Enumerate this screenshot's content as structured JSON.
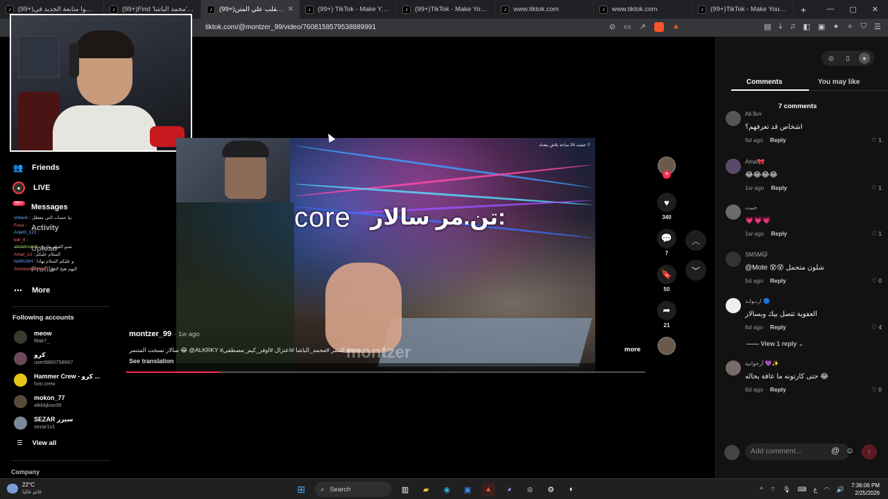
{
  "browser": {
    "tabs": [
      {
        "title": "(99+)لا تنسوا متابعة الجديد في",
        "active": false
      },
      {
        "title": "(99+)Find 'محمد الباشا' on TikTok",
        "active": false
      },
      {
        "title": "(99+)سالار ينقلب علي المتن",
        "active": true
      },
      {
        "title": "(99+) TikTok - Make Your Day",
        "active": false
      },
      {
        "title": "(99+)TikTok - Make Your Day",
        "active": false
      },
      {
        "title": "www.tiktok.com",
        "active": false
      },
      {
        "title": "www.tiktok.com",
        "active": false
      },
      {
        "title": "(99+)TikTok - Make Your Day",
        "active": false
      }
    ],
    "url": "tiktok.com/@montzer_99/video/7608158579538889991",
    "brave_badge": "1"
  },
  "sidebar": {
    "items": [
      {
        "label": "Friends",
        "icon": "friends-icon"
      },
      {
        "label": "LIVE",
        "icon": "live-icon"
      },
      {
        "label": "Messages",
        "icon": "messages-icon",
        "badge": "99+"
      },
      {
        "label": "Activity",
        "icon": "activity-icon"
      },
      {
        "label": "Upload",
        "icon": "upload-icon"
      },
      {
        "label": "Profile",
        "icon": "profile-icon"
      },
      {
        "label": "More",
        "icon": "more-icon"
      }
    ],
    "chat_overlay": [
      {
        "user": "shilann",
        "msg": "يبا حساب التي معطل"
      },
      {
        "user": "Foux",
        "msg": ""
      },
      {
        "user": "Anjel0_123",
        "msg": ""
      },
      {
        "user": "bdr_8",
        "msg": ""
      },
      {
        "user": "abdalmonid",
        "msg": "شنو القيهو بتاريخ"
      },
      {
        "user": "Amar_12",
        "msg": "السلام عليكم"
      },
      {
        "user": "NARUSH",
        "msg": "و عليكم السلام يهاذا"
      },
      {
        "user": "Someoneremas",
        "msg": "اليهم هيج الحق"
      }
    ],
    "following_title": "Following accounts",
    "following": [
      {
        "name": "meow",
        "handle": "f8ak7_",
        "color": "#3a3a2e"
      },
      {
        "name": "كرو",
        "handle": "user6860758967",
        "color": "#6a4a5a"
      },
      {
        "name": "Hammer Crew - كرو ...",
        "handle": "hmr.crew",
        "color": "#e6c619"
      },
      {
        "name": "mokon_77",
        "handle": "alkkkjkoo39",
        "color": "#5a4a3a"
      },
      {
        "name": "SEZAR سيزر",
        "handle": "sezar1x1",
        "color": "#7a8a9a"
      }
    ],
    "view_all": "View all",
    "company": "Company"
  },
  "video": {
    "top_note": "عشت 24 ساعة بلاش ببغداد !!",
    "overlay_en": "core",
    "overlay_ar": "تن.مر سالار:",
    "watermark": "montzer",
    "progress": 0.18
  },
  "post": {
    "author": "montzer_99",
    "when": "· 1w ago",
    "caption": "سالار نسخت المتنمر 😂 @ALKRKY #التنمر #محمد_الباشا #اعتزال #اوفر_كيم_مصطفى #core ...",
    "see_translation": "See translation",
    "more": "more"
  },
  "actions": {
    "likes": "340",
    "comments": "7",
    "saves": "50",
    "shares": "21"
  },
  "comments_panel": {
    "tab_comments": "Comments",
    "tab_you_may_like": "You may like",
    "count_label": "7 comments",
    "reply_label": "Reply",
    "view_reply": "View 1 reply",
    "add_placeholder": "Add comment...",
    "items": [
      {
        "user": "Ali.9ᴜʏ",
        "text": "اشخاص قد تعرفهم؟",
        "when": "6d ago",
        "likes": "1",
        "color": "#555"
      },
      {
        "user": "Amal🎀",
        "text": "😂😂😂😂",
        "when": "1w ago",
        "likes": "1",
        "color": "#5a4a6a"
      },
      {
        "user": "حبيت",
        "text": "💗💗💗",
        "when": "1w ago",
        "likes": "1",
        "color": "#6a6a6a"
      },
      {
        "user": "SMSM🐱",
        "text": "@Mote 😵😵 شلون متحمل",
        "when": "5d ago",
        "likes": "0",
        "color": "#333"
      },
      {
        "user": "ارنـولـد 🔵",
        "text": "العفوية تتصل بيك وبسالار",
        "when": "6d ago",
        "likes": "4",
        "color": "#eee"
      },
      {
        "user": "أرجوانية 💜✨",
        "text": "حتى كارتونه ما عافة بحاله 😂",
        "when": "6d ago",
        "likes": "0",
        "color": "#7a6a6a"
      }
    ]
  },
  "taskbar": {
    "temp": "22°C",
    "weather_text": "غائم غالبا",
    "search": "Search",
    "time": "7:36:06 PM",
    "date": "2/25/2026"
  }
}
